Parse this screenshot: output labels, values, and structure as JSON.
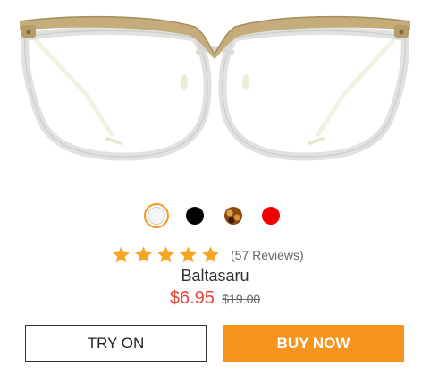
{
  "product": {
    "name": "Baltasaru",
    "image_icon": "eyeglasses-icon",
    "rating": 5,
    "rating_max": 5,
    "reviews_label": "(57 Reviews)",
    "price_current": "$6.95",
    "price_original": "$19.00"
  },
  "swatches": [
    {
      "name": "clear",
      "color": "#f4f4f4",
      "selected": true
    },
    {
      "name": "black",
      "color": "#000000",
      "selected": false
    },
    {
      "name": "tortoise",
      "color": "#8a4a12",
      "selected": false
    },
    {
      "name": "red",
      "color": "#ee0000",
      "selected": false
    }
  ],
  "buttons": {
    "try_on_label": "TRY ON",
    "buy_now_label": "BUY NOW"
  },
  "colors": {
    "accent": "#f7941d",
    "sale_price": "#e8443a",
    "star": "#f5a623"
  }
}
